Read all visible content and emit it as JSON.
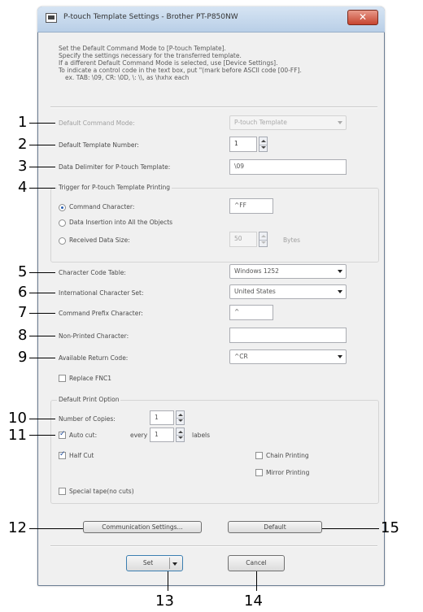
{
  "window": {
    "title": "P-touch Template Settings - Brother PT-P850NW",
    "close_glyph": "✕"
  },
  "description": [
    "Set the Default Command Mode to [P-touch Template].",
    "Specify the settings necessary for the transferred template.",
    "If a different Default Command Mode is selected, use [Device Settings].",
    "To indicate a control code in the text box, put \"(mark before ASCII code [00-FF].",
    "ex. TAB: \\09,  CR: \\0D,  \\: \\\\,  as \\hxhx each"
  ],
  "settings": {
    "default_command_mode": {
      "label": "Default Command Mode:",
      "value": "P-touch Template"
    },
    "default_template_number": {
      "label": "Default Template Number:",
      "value": "1"
    },
    "data_delimiter": {
      "label": "Data Delimiter for P-touch Template:",
      "value": "\\09"
    }
  },
  "trigger": {
    "group_title": "Trigger for P-touch Template Printing",
    "command_character": {
      "label": "Command Character:",
      "value": "^FF"
    },
    "data_insertion": {
      "label": "Data Insertion into All the Objects"
    },
    "received_data_size": {
      "label": "Received Data Size:",
      "value": "50",
      "unit": "Bytes"
    }
  },
  "encoding": {
    "character_code_table": {
      "label": "Character Code Table:",
      "value": "Windows 1252"
    },
    "international_character_set": {
      "label": "International Character Set:",
      "value": "United States"
    },
    "command_prefix_character": {
      "label": "Command Prefix Character:",
      "value": "^"
    },
    "non_printed_character": {
      "label": "Non-Printed Character:",
      "value": ""
    },
    "available_return_code": {
      "label": "Available Return Code:",
      "value": "^CR"
    },
    "replace_fnc1": {
      "label": "Replace FNC1"
    }
  },
  "print_option": {
    "group_title": "Default Print Option",
    "number_of_copies": {
      "label": "Number of Copies:",
      "value": "1"
    },
    "auto_cut": {
      "label": "Auto cut:",
      "every_label": "every",
      "value": "1",
      "unit": "labels"
    },
    "half_cut": {
      "label": "Half Cut"
    },
    "chain_printing": {
      "label": "Chain Printing"
    },
    "mirror_printing": {
      "label": "Mirror Printing"
    },
    "special_tape": {
      "label": "Special tape(no cuts)"
    }
  },
  "buttons": {
    "communication_settings": "Communication Settings...",
    "default": "Default",
    "set": "Set",
    "cancel": "Cancel"
  },
  "callouts": {
    "c1": "1",
    "c2": "2",
    "c3": "3",
    "c4": "4",
    "c5": "5",
    "c6": "6",
    "c7": "7",
    "c8": "8",
    "c9": "9",
    "c10": "10",
    "c11": "11",
    "c12": "12",
    "c13": "13",
    "c14": "14",
    "c15": "15"
  }
}
